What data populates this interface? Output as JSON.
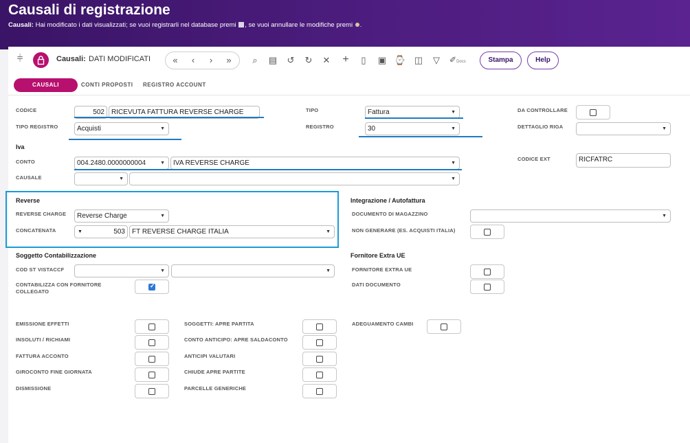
{
  "header": {
    "title": "Causali di registrazione",
    "subtitle_prefix": "Causali:",
    "subtitle_text1": " Hai modificato i dati visualizzati; se vuoi registrarli nel database premi ",
    "subtitle_text2": ", se vuoi annullare le modifiche premi ",
    "subtitle_end": "."
  },
  "toolbar": {
    "entity_label": "Causali:",
    "status": "DATI MODIFICATI",
    "docs_label": "Docs",
    "print_label": "Stampa",
    "help_label": "Help"
  },
  "tabs": [
    "CAUSALI",
    "CONTI PROPOSTI",
    "REGISTRO ACCOUNT"
  ],
  "form": {
    "codice": {
      "label": "CODICE",
      "number": "502",
      "desc": "RICEVUTA FATTURA REVERSE CHARGE"
    },
    "tipo_registro": {
      "label": "TIPO REGISTRO",
      "value": "Acquisti"
    },
    "tipo": {
      "label": "TIPO",
      "value": "Fattura"
    },
    "registro": {
      "label": "REGISTRO",
      "value": "30"
    },
    "da_controllare": {
      "label": "DA CONTROLLARE",
      "checked": false
    },
    "dettaglio_riga": {
      "label": "DETTAGLIO RIGA",
      "value": ""
    },
    "iva_title": "Iva",
    "conto": {
      "label": "CONTO",
      "code": "004.2480.0000000004",
      "desc": "IVA REVERSE CHARGE"
    },
    "causale": {
      "label": "CAUSALE",
      "code": "",
      "desc": ""
    },
    "codice_ext": {
      "label": "CODICE EXT",
      "value": "RICFATRC"
    },
    "reverse_title": "Reverse",
    "reverse_charge": {
      "label": "REVERSE CHARGE",
      "value": "Reverse Charge"
    },
    "concatenata": {
      "label": "CONCATENATA",
      "number": "503",
      "desc": "FT REVERSE CHARGE ITALIA"
    },
    "integrazione_title": "Integrazione / Autofattura",
    "documento_magazzino": {
      "label": "DOCUMENTO DI MAGAZZINO",
      "value": ""
    },
    "non_generare": {
      "label": "NON GENERARE (ES. ACQUISTI ITALIA)",
      "checked": false
    },
    "soggetto_title": "Soggetto Contabilizzazione",
    "cod_st_vistaccf": {
      "label": "COD ST VISTACCF",
      "code": "",
      "desc": ""
    },
    "contabilizza": {
      "label1": "CONTABILIZZA CON FORNITORE",
      "label2": "COLLEGATO",
      "checked": true
    },
    "fornitore_title": "Fornitore Extra UE",
    "fornitore_extra_ue": {
      "label": "FORNITORE EXTRA UE",
      "checked": false
    },
    "dati_documento": {
      "label": "DATI DOCUMENTO",
      "checked": false
    },
    "emissione_effetti": {
      "label": "EMISSIONE EFFETTI",
      "checked": false
    },
    "insoluti": {
      "label": "INSOLUTI / RICHIAMI",
      "checked": false
    },
    "fattura_acconto": {
      "label": "FATTURA ACCONTO",
      "checked": false
    },
    "giroconto": {
      "label": "GIROCONTO FINE GIORNATA",
      "checked": false
    },
    "dismissione": {
      "label": "DISMISSIONE",
      "checked": false
    },
    "soggetti_partita": {
      "label": "SOGGETTI: APRE PARTITA",
      "checked": false
    },
    "conto_anticipo": {
      "label": "CONTO ANTICIPO: APRE SALDACONTO",
      "checked": false
    },
    "anticipi_valutari": {
      "label": "ANTICIPI VALUTARI",
      "checked": false
    },
    "chiude_partite": {
      "label": "CHIUDE APRE PARTITE",
      "checked": false
    },
    "parcelle": {
      "label": "PARCELLE GENERICHE",
      "checked": false
    },
    "adeguamento": {
      "label": "ADEGUAMENTO CAMBI",
      "checked": false
    }
  },
  "colors": {
    "header_bg": "#4d1d7f",
    "accent": "#b8106e",
    "underline": "#1f7ac2",
    "highlight_box": "#1a9ad6"
  }
}
